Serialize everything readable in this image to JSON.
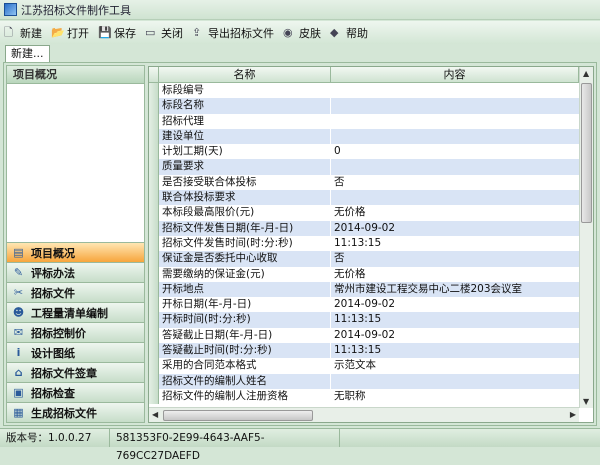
{
  "window": {
    "title": "江苏招标文件制作工具"
  },
  "toolbar": [
    {
      "label": "新建",
      "icon": "new-file-icon"
    },
    {
      "label": "打开",
      "icon": "open-folder-icon"
    },
    {
      "label": "保存",
      "icon": "save-icon"
    },
    {
      "label": "关闭",
      "icon": "close-file-icon"
    },
    {
      "label": "导出招标文件",
      "icon": "export-icon"
    },
    {
      "label": "皮肤",
      "icon": "skin-icon"
    },
    {
      "label": "帮助",
      "icon": "help-book-icon"
    }
  ],
  "tabs": [
    {
      "label": "新建..."
    }
  ],
  "left_panel": {
    "title": "项目概况",
    "nav": [
      {
        "label": "项目概况",
        "icon": "document-icon",
        "active": true
      },
      {
        "label": "评标办法",
        "icon": "evaluate-icon"
      },
      {
        "label": "招标文件",
        "icon": "tools-icon"
      },
      {
        "label": "工程量清单编制",
        "icon": "users-icon"
      },
      {
        "label": "招标控制价",
        "icon": "envelope-icon"
      },
      {
        "label": "设计图纸",
        "icon": "info-icon"
      },
      {
        "label": "招标文件签章",
        "icon": "home-icon"
      },
      {
        "label": "招标检查",
        "icon": "folder-icon"
      },
      {
        "label": "生成招标文件",
        "icon": "form-icon"
      }
    ]
  },
  "grid": {
    "columns": [
      "名称",
      "内容"
    ],
    "rows": [
      [
        "标段编号",
        ""
      ],
      [
        "标段名称",
        ""
      ],
      [
        "招标代理",
        ""
      ],
      [
        "建设单位",
        ""
      ],
      [
        "计划工期(天)",
        "0"
      ],
      [
        "质量要求",
        ""
      ],
      [
        "是否接受联合体投标",
        "否"
      ],
      [
        "联合体投标要求",
        ""
      ],
      [
        "本标段最高限价(元)",
        "无价格"
      ],
      [
        "招标文件发售日期(年-月-日)",
        "2014-09-02"
      ],
      [
        "招标文件发售时间(时:分:秒)",
        "11:13:15"
      ],
      [
        "保证金是否委托中心收取",
        "否"
      ],
      [
        "需要缴纳的保证金(元)",
        "无价格"
      ],
      [
        "开标地点",
        "常州市建设工程交易中心二楼203会议室"
      ],
      [
        "开标日期(年-月-日)",
        "2014-09-02"
      ],
      [
        "开标时间(时:分:秒)",
        "11:13:15"
      ],
      [
        "答疑截止日期(年-月-日)",
        "2014-09-02"
      ],
      [
        "答疑截止时间(时:分:秒)",
        "11:13:15"
      ],
      [
        "采用的合同范本格式",
        "示范文本"
      ],
      [
        "招标文件的编制人姓名",
        ""
      ],
      [
        "招标文件的编制人注册资格",
        "无职称"
      ]
    ],
    "row_colors": {
      "even": "#ffffff",
      "odd": "#d9e4f5"
    }
  },
  "status": {
    "version": "版本号：1.0.0.27",
    "id": "581353F0-2E99-4643-AAF5-769CC27DAEFD"
  }
}
